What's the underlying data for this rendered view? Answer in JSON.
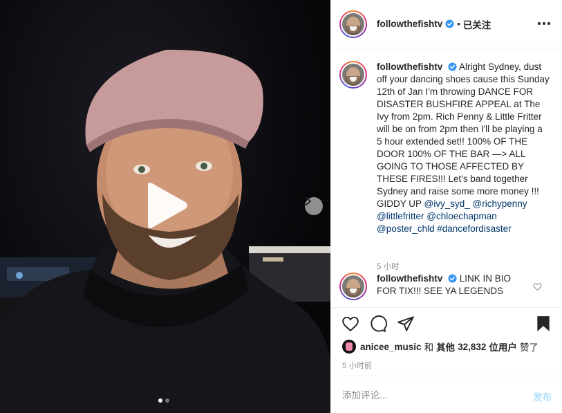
{
  "header": {
    "username": "followthefishtv",
    "separator": "•",
    "follow_status": "已关注"
  },
  "caption": {
    "username": "followthefishtv",
    "text": "Alright Sydney, dust off your dancing shoes cause this Sunday 12th of Jan I'm throwing DANCE FOR DISASTER BUSHFIRE APPEAL at The Ivy from 2pm. Rich Penny & Little Fritter will be on from 2pm then I'll be playing a 5 hour extended set!! 100% OF THE DOOR 100% OF THE BAR —> ALL GOING TO THOSE AFFECTED BY THESE FIRES!!! Let's band together Sydney and raise some more money !!! GIDDY UP",
    "mentions": [
      "@ivy_syd_",
      "@richypenny",
      "@littlefritter",
      "@chloechapman",
      "@poster_chld",
      "#dancefordisaster"
    ],
    "time": "5 小时"
  },
  "reply": {
    "username": "followthefishtv",
    "text": "LINK IN BIO FOR TIX!!! SEE YA LEGENDS"
  },
  "likes": {
    "username": "anicee_music",
    "and": "和",
    "others_label": "其他",
    "count": "32,832",
    "suffix": "位用户",
    "liked": "赞了"
  },
  "post_time": "5 小时前",
  "comment_box": {
    "placeholder": "添加评论...",
    "post_label": "发布"
  },
  "media": {
    "carousel_count": 2,
    "carousel_active": 0
  },
  "icons": {
    "play": "play-icon",
    "next": "chevron-right-icon",
    "more": "more-horizontal-icon",
    "verified": "verified-badge-icon",
    "like": "heart-icon",
    "comment": "comment-icon",
    "share": "share-icon",
    "save": "bookmark-icon"
  },
  "colors": {
    "verified": "#3897f0",
    "link": "#00376b",
    "post_disabled": "#b2dffc",
    "muted": "#8e8e8e"
  }
}
